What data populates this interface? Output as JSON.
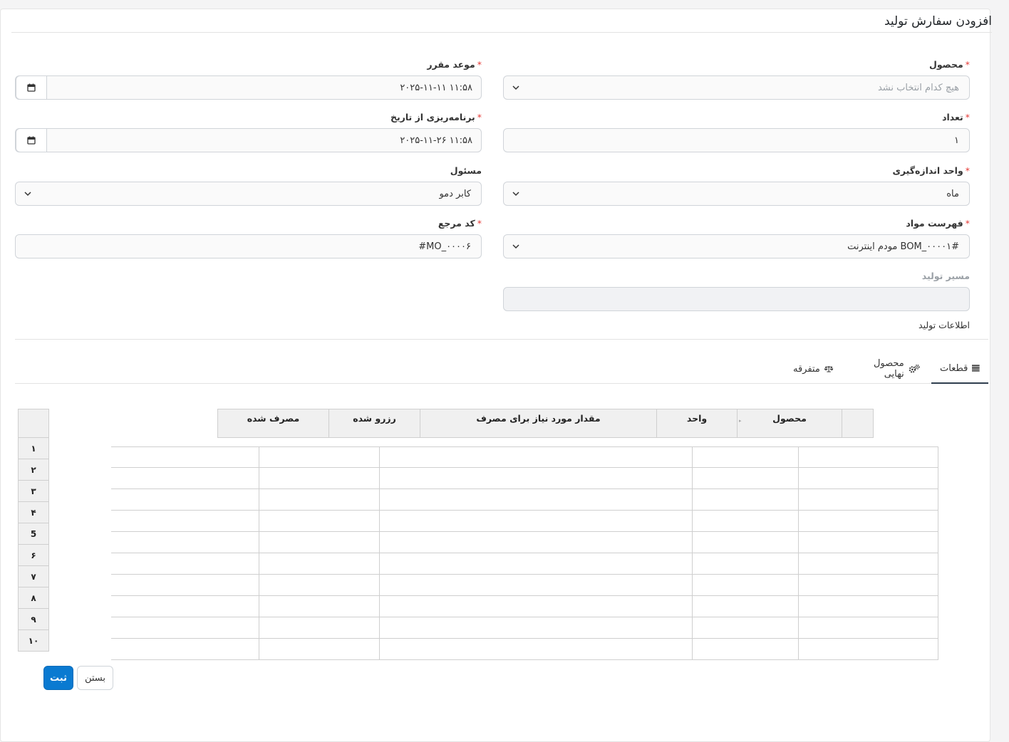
{
  "page": {
    "title": "افزودن سفارش تولید"
  },
  "fields": {
    "product": {
      "label": "محصول",
      "required": true,
      "value": "",
      "placeholder": "هیچ کدام انتخاب نشد"
    },
    "deadline": {
      "label": "موعد مقرر",
      "required": true,
      "value": "۲۰۲۵-۱۱-۱۱ ۱۱:۵۸"
    },
    "quantity": {
      "label": "تعداد",
      "required": true,
      "value": "۱"
    },
    "schedule_from": {
      "label": "برنامه‌ریزی از تاریخ",
      "required": true,
      "value": "۲۰۲۵-۱۱-۲۶ ۱۱:۵۸"
    },
    "uom": {
      "label": "واحد اندازه‌گیری",
      "required": true,
      "value": "ماه"
    },
    "responsible": {
      "label": "مسئول",
      "required": false,
      "value": "کابر دمو"
    },
    "bom": {
      "label": "فهرست مواد",
      "required": true,
      "value": "#BOM_۰۰۰۰۱ مودم اینترنت"
    },
    "reference": {
      "label": "کد مرجع",
      "required": true,
      "value": "#MO_۰۰۰۰۶"
    },
    "routing": {
      "label": "مسیر تولید",
      "required": false,
      "value": ""
    }
  },
  "section": {
    "label": "اطلاعات تولید"
  },
  "tabs": [
    {
      "label": "قطعات",
      "icon": "list-icon",
      "active": true
    },
    {
      "label": "محصول نهایی",
      "icon": "gears-icon",
      "active": false
    },
    {
      "label": "متفرقه",
      "icon": "scale-icon",
      "active": false
    }
  ],
  "table": {
    "columns": [
      "محصول",
      "واحد",
      "مقدار مورد نیاز برای مصرف",
      "رزرو شده",
      "مصرف شده"
    ],
    "row_numbers": [
      "۱",
      "۲",
      "۳",
      "۴",
      "5",
      "۶",
      "۷",
      "۸",
      "۹",
      "۱۰"
    ]
  },
  "buttons": {
    "submit": "ثبت",
    "close": "بستن"
  },
  "colors": {
    "primary": "#0a7ad1",
    "required": "#e53935",
    "tab_active": "#2f3e4e"
  }
}
